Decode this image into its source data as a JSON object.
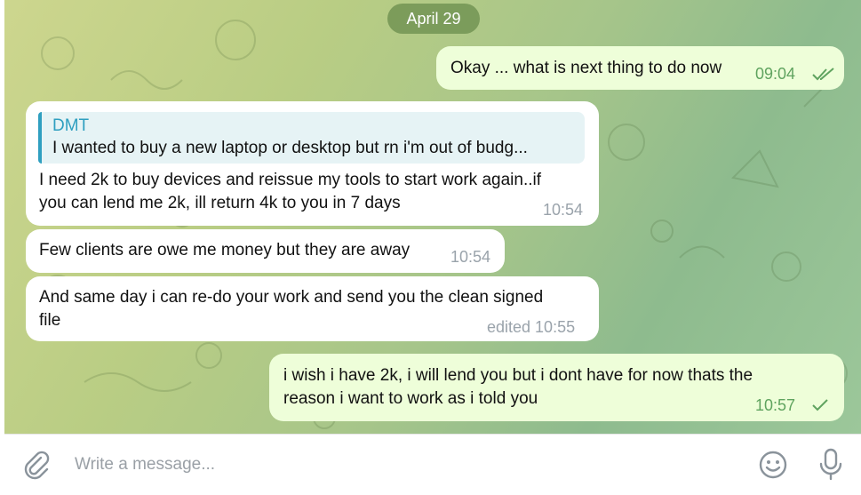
{
  "chat": {
    "date_label": "April 29",
    "messages": [
      {
        "direction": "out",
        "text": "Okay ... what is next thing to do now",
        "time": "09:04",
        "status": "read"
      },
      {
        "direction": "in",
        "reply": {
          "name": "DMT",
          "text": "I wanted to buy a new laptop or desktop but rn i'm out of budg..."
        },
        "text_lines": [
          "I need 2k to buy devices and reissue my tools to start work again..if",
          "you can lend me 2k, ill return 4k to you in 7 days"
        ],
        "time": "10:54"
      },
      {
        "direction": "in",
        "text": "Few clients are owe me money but they are away",
        "time": "10:54"
      },
      {
        "direction": "in",
        "text_lines": [
          "And same day i can re-do your work and send you the clean signed",
          "file"
        ],
        "time": "edited 10:55"
      },
      {
        "direction": "out",
        "text_lines": [
          "i wish i have 2k, i will lend you but i dont have for now thats the",
          "reason i want to work as i told you"
        ],
        "time": "10:57",
        "status": "sent"
      }
    ]
  },
  "composer": {
    "placeholder": "Write a message...",
    "attach_icon": "paperclip-icon",
    "emoji_icon": "smile-icon",
    "mic_icon": "microphone-icon"
  },
  "colors": {
    "outgoing_bubble": "#eefed9",
    "incoming_bubble": "#ffffff",
    "accent": "#2f9fc0",
    "check": "#5fa35f"
  }
}
